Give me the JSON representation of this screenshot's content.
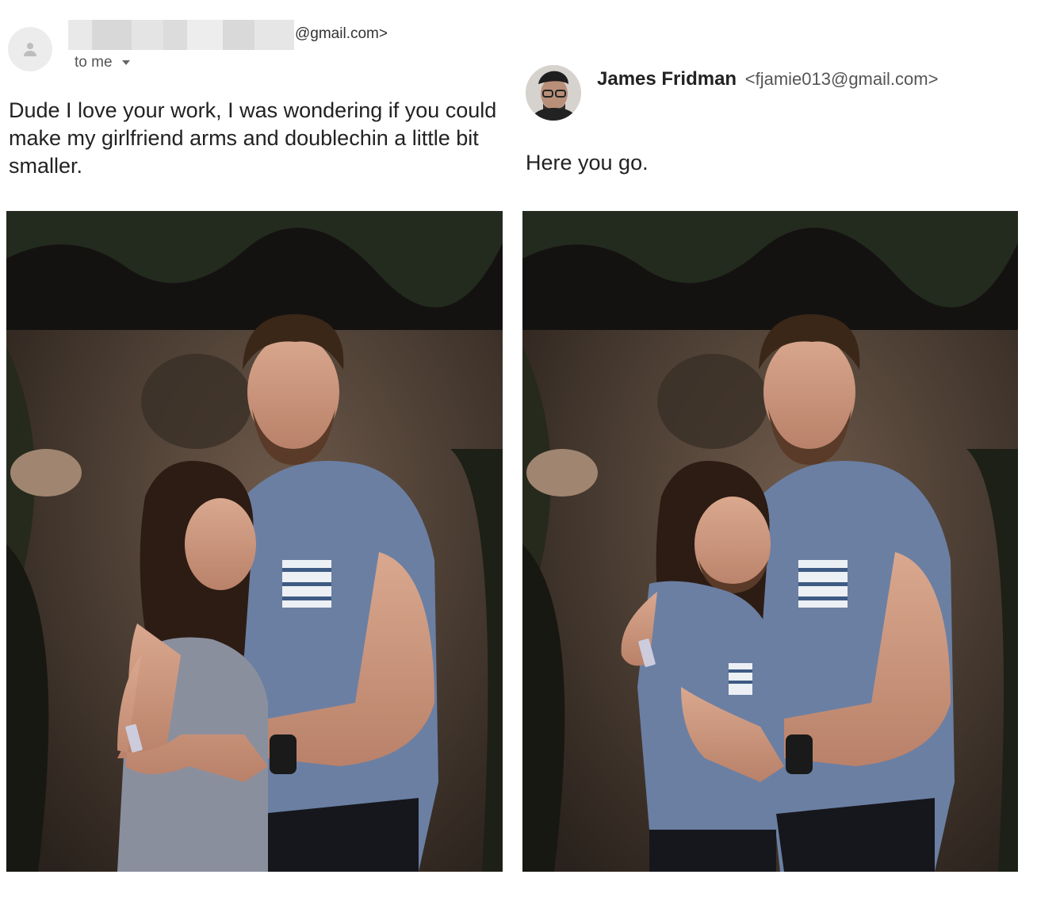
{
  "email_left": {
    "sender_email_suffix": "@gmail.com>",
    "recipient_label": "to me",
    "message": "Dude I love your work, I was wondering if you could make my girlfriend arms and doublechin a little bit smaller."
  },
  "email_right": {
    "sender_name": "James Fridman",
    "sender_address": "<fjamie013@gmail.com>",
    "message": "Here you go."
  },
  "icons": {
    "sender_avatar": "person-icon",
    "dropdown": "caret-down-icon"
  },
  "colors": {
    "text": "#222222",
    "muted": "#555555",
    "avatar_bg": "#ececec",
    "shirt": "#6b7fa3"
  }
}
